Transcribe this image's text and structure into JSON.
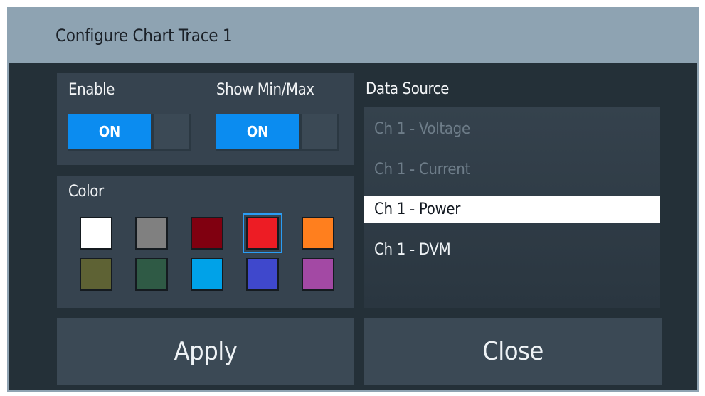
{
  "dialog": {
    "title": "Configure Chart Trace 1"
  },
  "enable": {
    "label": "Enable",
    "toggle_value": "ON"
  },
  "show_minmax": {
    "label": "Show Min/Max",
    "toggle_value": "ON"
  },
  "color": {
    "label": "Color",
    "swatches": [
      "#ffffff",
      "#808080",
      "#800010",
      "#ed1c24",
      "#ff7f1e",
      "#5e6234",
      "#2f5a45",
      "#00a2e8",
      "#3f48cc",
      "#a349a4"
    ],
    "selected_index": 3
  },
  "data_source": {
    "label": "Data Source",
    "items": [
      "Ch 1 - Voltage",
      "Ch 1 - Current",
      "Ch 1 - Power",
      "Ch 1 - DVM"
    ],
    "selected": "Ch 1 - Power"
  },
  "buttons": {
    "apply": "Apply",
    "close": "Close"
  }
}
